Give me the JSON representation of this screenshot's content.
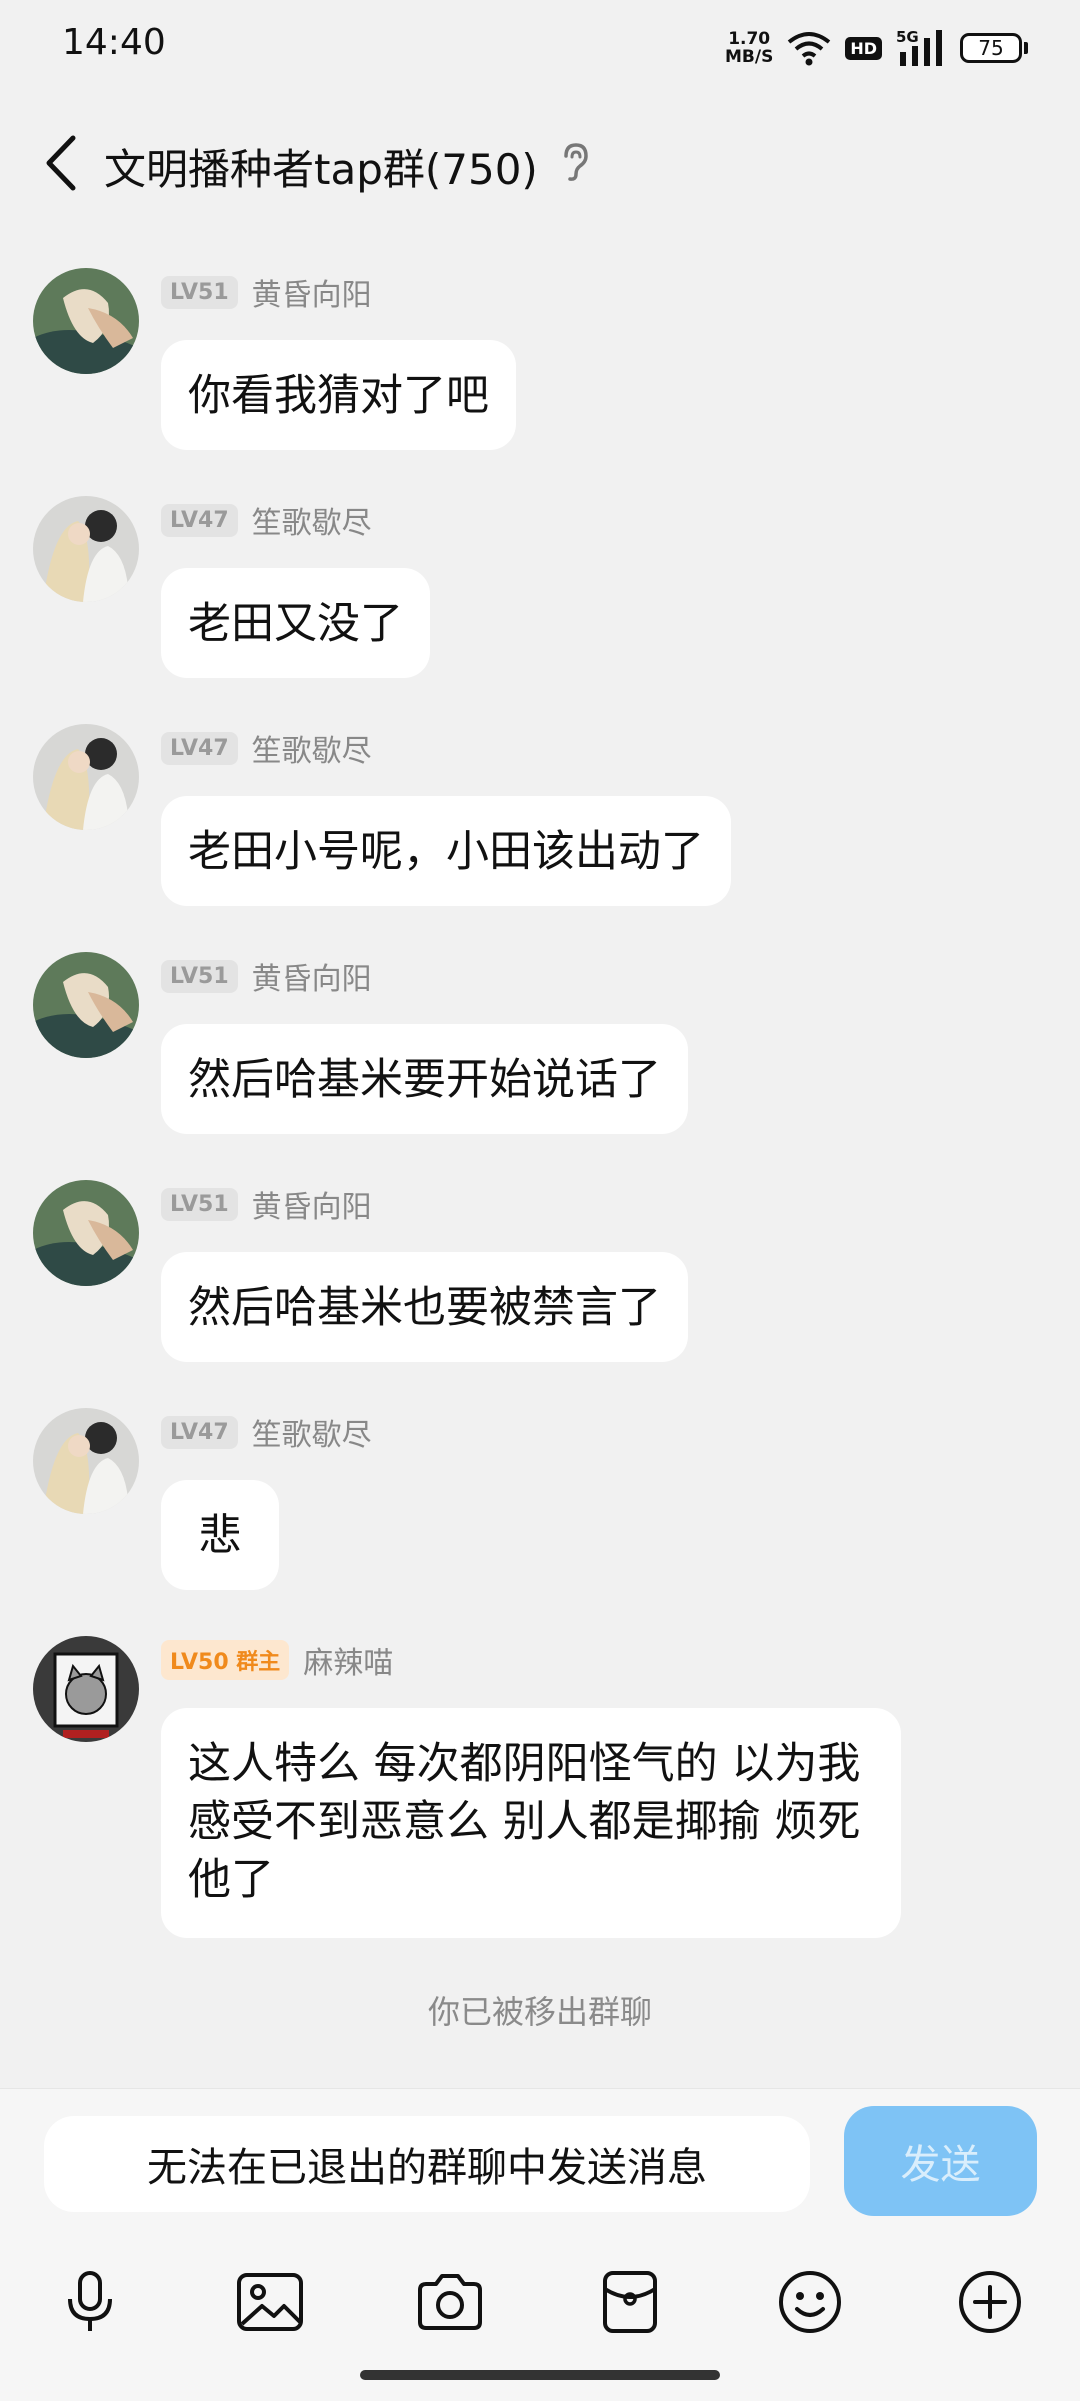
{
  "status_bar": {
    "time": "14:40",
    "net_speed_value": "1.70",
    "net_speed_unit": "MB/S",
    "hd": "HD",
    "network": "5G",
    "battery": "75"
  },
  "header": {
    "title": "文明播种者tap群(750)",
    "back_icon": "chevron-left-icon",
    "ear_icon": "ear-icon"
  },
  "messages": [
    {
      "level": "LV51",
      "role": "",
      "name": "黄昏向阳",
      "text": "你看我猜对了吧"
    },
    {
      "level": "LV47",
      "role": "",
      "name": "笙歌歇尽",
      "text": "老田又没了"
    },
    {
      "level": "LV47",
      "role": "",
      "name": "笙歌歇尽",
      "text": "老田小号呢，小田该出动了"
    },
    {
      "level": "LV51",
      "role": "",
      "name": "黄昏向阳",
      "text": "然后哈基米要开始说话了"
    },
    {
      "level": "LV51",
      "role": "",
      "name": "黄昏向阳",
      "text": "然后哈基米也要被禁言了"
    },
    {
      "level": "LV47",
      "role": "",
      "name": "笙歌歇尽",
      "text": "悲"
    },
    {
      "level": "LV50 群主",
      "role": "owner",
      "name": "麻辣喵",
      "text": "这人特么 每次都阴阳怪气的 以为我感受不到恶意么 别人都是揶揄 烦死他了"
    }
  ],
  "system_note": "你已被移出群聊",
  "input": {
    "placeholder": "无法在已退出的群聊中发送消息",
    "send_label": "发送"
  },
  "toolbar": [
    "microphone-icon",
    "image-icon",
    "camera-icon",
    "red-packet-icon",
    "emoji-icon",
    "plus-icon"
  ],
  "colors": {
    "background": "#f1f1f1",
    "bubble": "#ffffff",
    "send_button": "#7ec3f5",
    "owner_badge": "#f08a1c"
  }
}
